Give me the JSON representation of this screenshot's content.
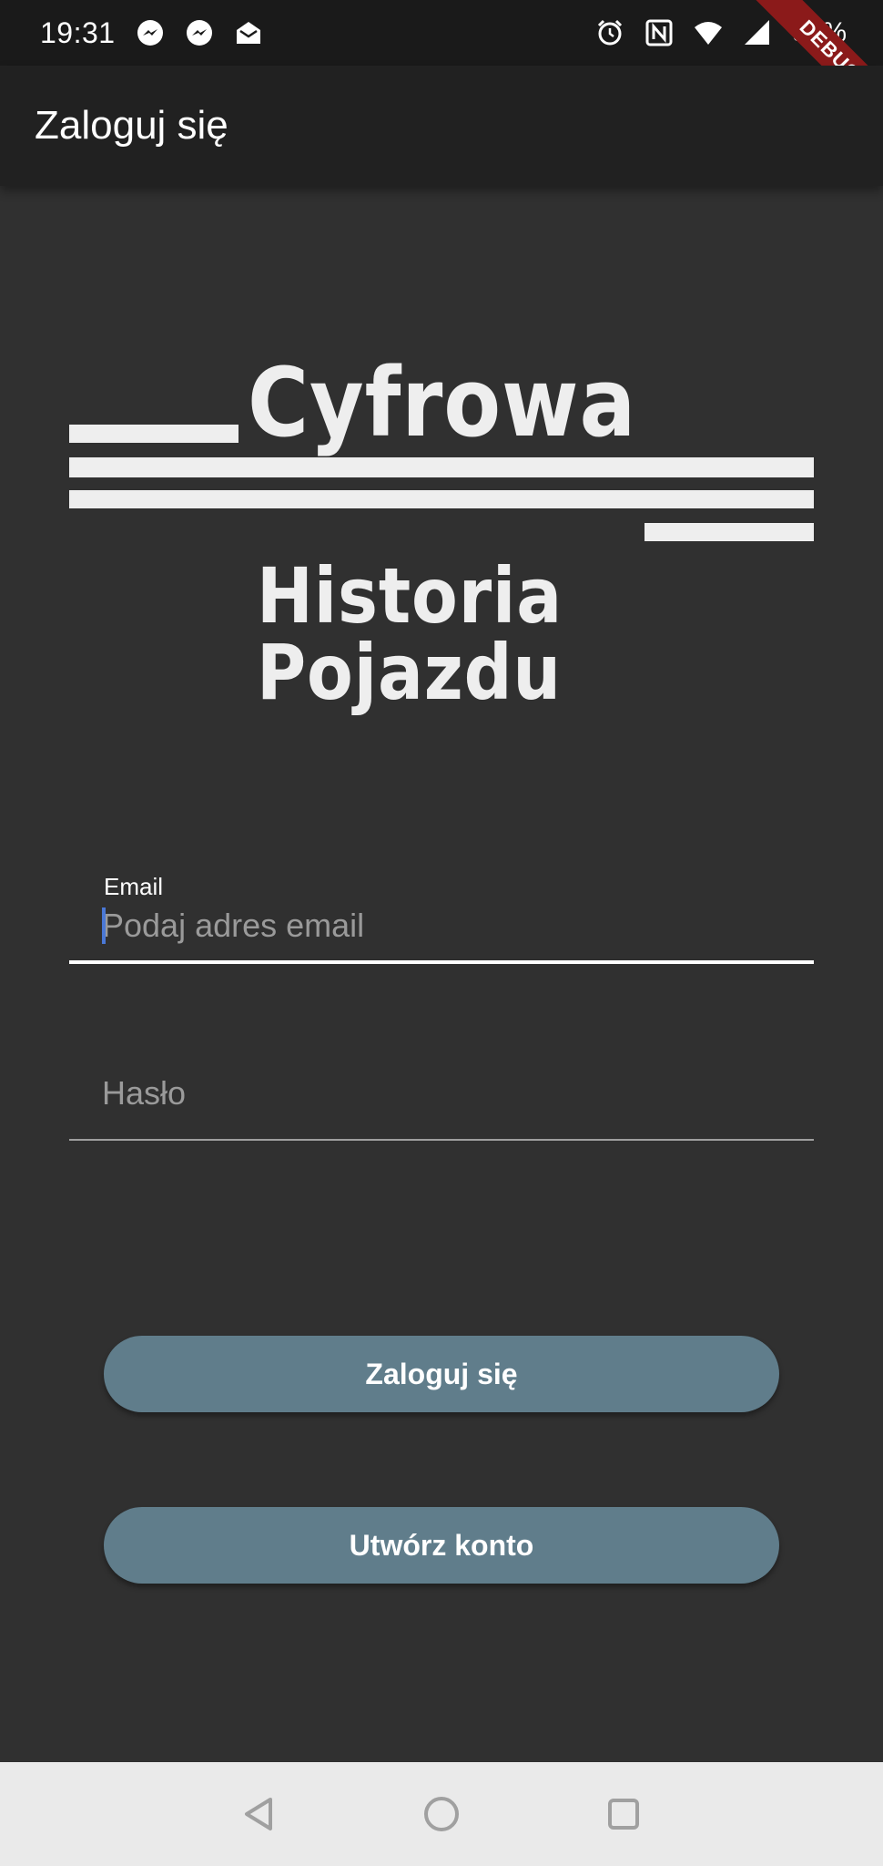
{
  "status_bar": {
    "time": "19:31",
    "battery": "98%",
    "left_icons": [
      "messenger-icon",
      "messenger-icon",
      "mail-icon"
    ],
    "right_icons": [
      "alarm-icon",
      "nfc-icon",
      "wifi-icon",
      "signal-icon"
    ]
  },
  "debug_banner": "DEBUG",
  "app_bar": {
    "title": "Zaloguj się"
  },
  "logo": {
    "line1": "Cyfrowa",
    "line2": "Historia Pojazdu"
  },
  "form": {
    "email": {
      "label": "Email",
      "placeholder": "Podaj adres email",
      "value": ""
    },
    "password": {
      "placeholder": "Hasło",
      "value": ""
    }
  },
  "buttons": {
    "login": "Zaloguj się",
    "register": "Utwórz konto"
  },
  "nav": [
    "back-icon",
    "home-icon",
    "recents-icon"
  ],
  "colors": {
    "background": "#303030",
    "app_bar": "#212121",
    "button": "#607d8b",
    "caret": "#4a78d6",
    "debug": "#8b1a1a"
  }
}
